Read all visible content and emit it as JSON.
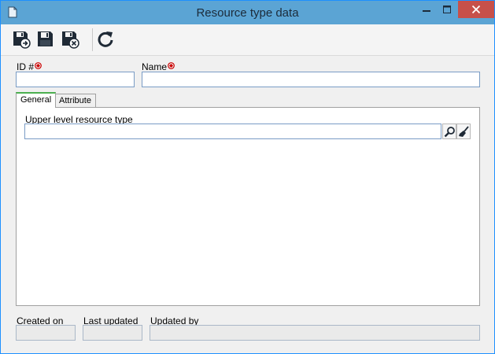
{
  "window": {
    "title": "Resource type data"
  },
  "toolbar": {
    "buttons": [
      {
        "icon": "save-and-new-icon"
      },
      {
        "icon": "save-icon"
      },
      {
        "icon": "save-and-close-icon"
      },
      {
        "icon": "refresh-icon"
      }
    ]
  },
  "form": {
    "id_label": "ID #",
    "id_value": "",
    "name_label": "Name",
    "name_value": "",
    "required_color": "#cc0000"
  },
  "tabs": [
    {
      "label": "General",
      "active": true
    },
    {
      "label": "Attribute",
      "active": false
    }
  ],
  "general": {
    "upper_level_label": "Upper level resource type",
    "upper_level_value": ""
  },
  "footer": {
    "created_on_label": "Created on",
    "created_on_value": "",
    "last_updated_label": "Last updated",
    "last_updated_value": "",
    "updated_by_label": "Updated by",
    "updated_by_value": ""
  },
  "colors": {
    "titlebar": "#5ba4d4",
    "close_button": "#c7504a",
    "active_tab_accent": "#4caf50"
  }
}
